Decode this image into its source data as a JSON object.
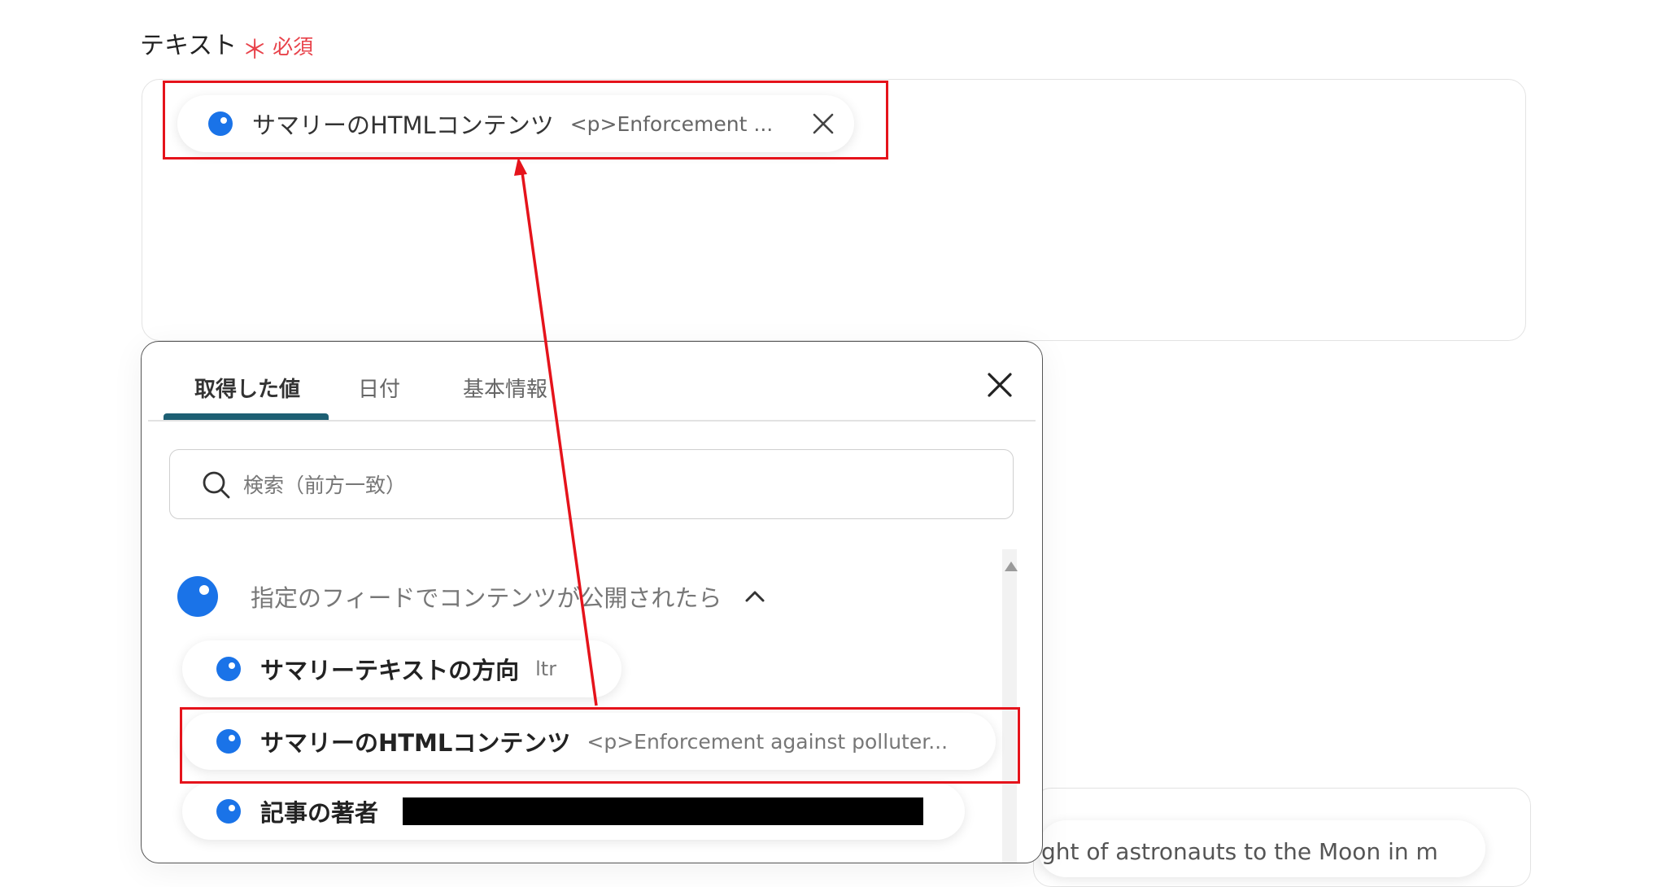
{
  "field": {
    "label": "テキスト",
    "required_star": "＊",
    "required_text": "必須"
  },
  "selected_chip": {
    "label": "サマリーのHTMLコンテンツ",
    "value": "<p>Enforcement ..."
  },
  "picker": {
    "tabs": [
      "取得した値",
      "日付",
      "基本情報"
    ],
    "active_tab": "取得した値",
    "search_placeholder": "検索（前方一致）",
    "group": {
      "label": "指定のフィードでコンテンツが公開されたら",
      "items": [
        {
          "label": "サマリーテキストの方向",
          "value": "ltr"
        },
        {
          "label": "サマリーのHTMLコンテンツ",
          "value": "<p>Enforcement against polluter..."
        },
        {
          "label": "記事の著者",
          "value": "[redacted]"
        }
      ]
    }
  },
  "background_text": "ght of astronauts to the Moon in m",
  "colors": {
    "accent_blue": "#1a73e8",
    "tab_underline": "#1d5f73",
    "required_red": "#e8424a",
    "highlight_red": "#e5131b"
  },
  "icons": [
    "close-icon",
    "search-icon",
    "chevron-up-icon",
    "source-dot-icon"
  ]
}
